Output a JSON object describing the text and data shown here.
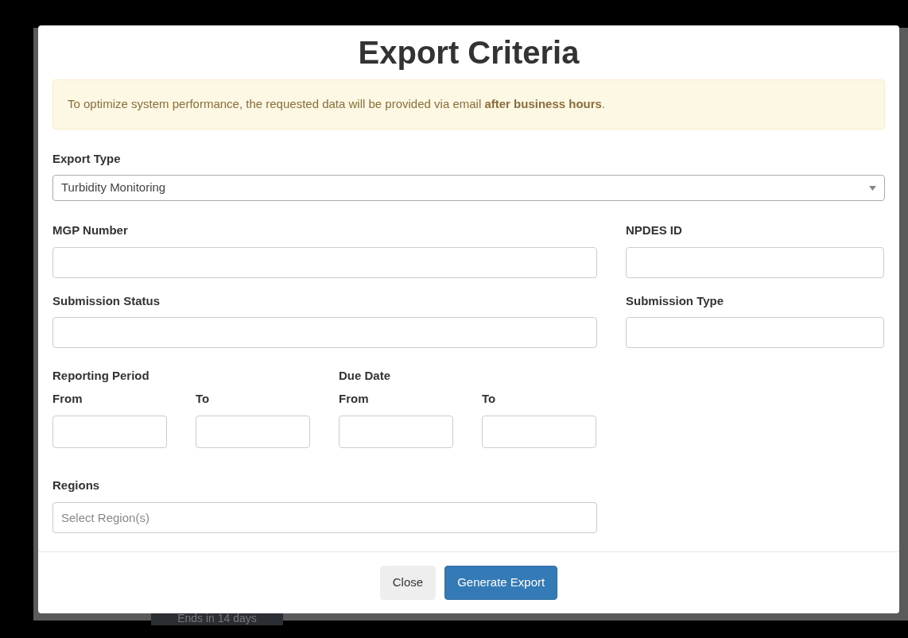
{
  "background": {
    "badge": "Ends in 14 days"
  },
  "modal": {
    "title": "Export Criteria",
    "alert": "To optimize system performance, the requested data will be provided via email **after business hours**.",
    "export_type": {
      "label": "Export Type",
      "value": "Turbidity Monitoring"
    },
    "text_fields": [
      {
        "label": "MGP Number",
        "kind": "wide"
      },
      {
        "label": "NPDES ID",
        "kind": "narrow"
      },
      {
        "label": "Submission Status",
        "kind": "wide"
      },
      {
        "label": "Submission Type",
        "kind": "narrow"
      }
    ],
    "date_groups": [
      {
        "label": "Reporting Period",
        "from": "From",
        "to": "To"
      },
      {
        "label": "Due Date",
        "from": "From",
        "to": "To"
      }
    ],
    "regions": {
      "label": "Regions",
      "placeholder": "Select Region(s)"
    },
    "buttons": [
      {
        "label": "Close",
        "kind": "secondary"
      },
      {
        "label": "Generate Export",
        "kind": "primary"
      }
    ]
  }
}
